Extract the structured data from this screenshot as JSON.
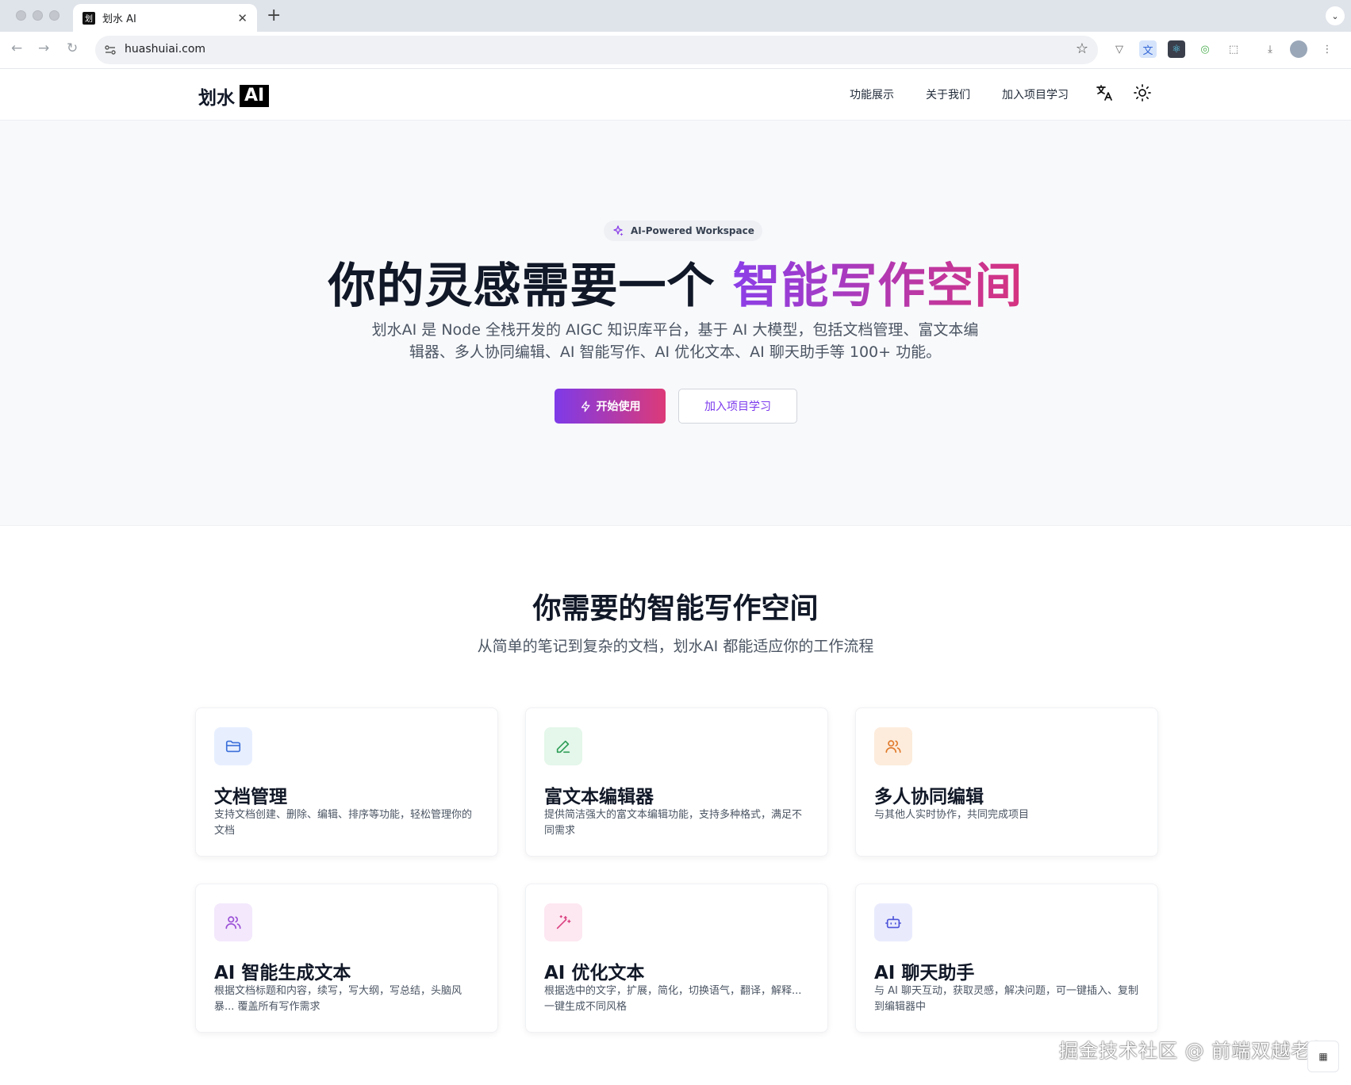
{
  "browser": {
    "tab_title": "划水 AI",
    "tab_favicon": "划",
    "url": "huashuiai.com"
  },
  "header": {
    "logo_text": "划水",
    "logo_badge": "AI",
    "nav": [
      "功能展示",
      "关于我们",
      "加入项目学习"
    ]
  },
  "hero": {
    "badge": "AI-Powered Workspace",
    "title_plain": "你的灵感需要一个 ",
    "title_gradient": "智能写作空间",
    "description": "划水AI 是 Node 全栈开发的 AIGC 知识库平台，基于 AI 大模型，包括文档管理、富文本编辑器、多人协同编辑、AI 智能写作、AI 优化文本、AI 聊天助手等 100+ 功能。",
    "primary_button": "开始使用",
    "secondary_button": "加入项目学习"
  },
  "features": {
    "title": "你需要的智能写作空间",
    "subtitle": "从简单的笔记到复杂的文档，划水AI 都能适应你的工作流程",
    "cards": [
      {
        "title": "文档管理",
        "desc": "支持文档创建、删除、编辑、排序等功能，轻松管理你的文档",
        "icon": "folder-icon",
        "bg": "#e7efff",
        "color": "#3b6fd9"
      },
      {
        "title": "富文本编辑器",
        "desc": "提供简洁强大的富文本编辑功能，支持多种格式，满足不同需求",
        "icon": "pencil-icon",
        "bg": "#e4f7ea",
        "color": "#2e9e57"
      },
      {
        "title": "多人协同编辑",
        "desc": "与其他人实时协作，共同完成项目",
        "icon": "users-icon",
        "bg": "#fdecdc",
        "color": "#e07a2c"
      },
      {
        "title": "AI 智能生成文本",
        "desc": "根据文档标题和内容，续写，写大纲，写总结，头脑风暴... 覆盖所有写作需求",
        "icon": "users-icon",
        "bg": "#f3e8fc",
        "color": "#9a4fd6"
      },
      {
        "title": "AI 优化文本",
        "desc": "根据选中的文字，扩展，简化，切换语气，翻译，解释... 一键生成不同风格",
        "icon": "magic-wand-icon",
        "bg": "#fde7f1",
        "color": "#d9407f"
      },
      {
        "title": "AI 聊天助手",
        "desc": "与 AI 聊天互动，获取灵感，解决问题，可一键插入、复制到编辑器中",
        "icon": "bot-icon",
        "bg": "#e9ebfd",
        "color": "#4f55d9"
      }
    ]
  },
  "watermark": "掘金技术社区 @ 前端双越老师"
}
